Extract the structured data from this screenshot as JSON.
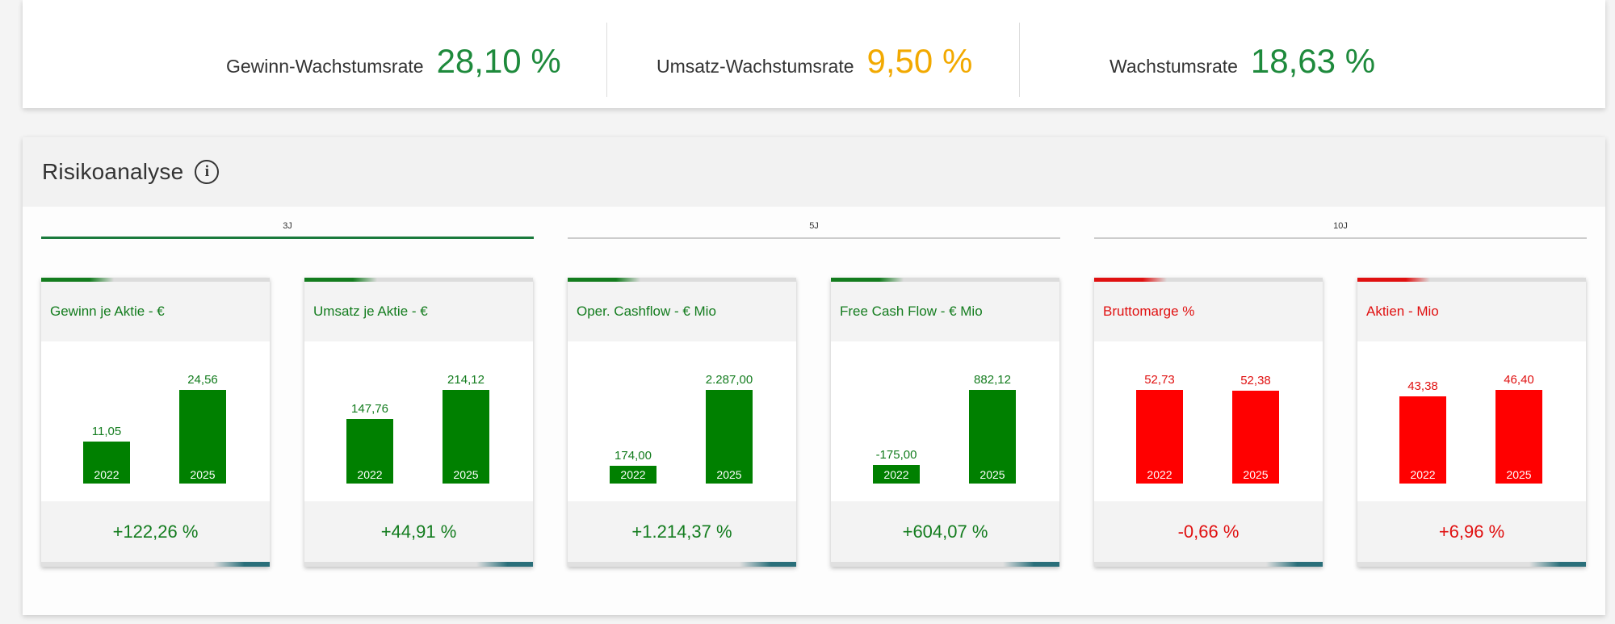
{
  "growth": [
    {
      "label": "Gewinn-Wachstumsrate",
      "value": "28,10 %",
      "tone": "green"
    },
    {
      "label": "Umsatz-Wachstumsrate",
      "value": "9,50 %",
      "tone": "amber"
    },
    {
      "label": "Wachstumsrate",
      "value": "18,63 %",
      "tone": "green"
    }
  ],
  "risk": {
    "title": "Risikoanalyse",
    "info_icon": "info-circle-icon",
    "periods": [
      {
        "label": "3J",
        "active": true
      },
      {
        "label": "5J",
        "active": false
      },
      {
        "label": "10J",
        "active": false
      }
    ],
    "cards": [
      {
        "title": "Gewinn je Aktie - €",
        "tone": "positive",
        "bars": [
          {
            "year": "2022",
            "value": "11,05",
            "num": 11.05
          },
          {
            "year": "2025",
            "value": "24,56",
            "num": 24.56
          }
        ],
        "change": "+122,26 %"
      },
      {
        "title": "Umsatz je Aktie - €",
        "tone": "positive",
        "bars": [
          {
            "year": "2022",
            "value": "147,76",
            "num": 147.76
          },
          {
            "year": "2025",
            "value": "214,12",
            "num": 214.12
          }
        ],
        "change": "+44,91 %"
      },
      {
        "title": "Oper. Cashflow - € Mio",
        "tone": "positive",
        "bars": [
          {
            "year": "2022",
            "value": "174,00",
            "num": 174.0
          },
          {
            "year": "2025",
            "value": "2.287,00",
            "num": 2287.0
          }
        ],
        "change": "+1.214,37 %"
      },
      {
        "title": "Free Cash Flow - € Mio",
        "tone": "positive",
        "bars": [
          {
            "year": "2022",
            "value": "-175,00",
            "num": -175.0
          },
          {
            "year": "2025",
            "value": "882,12",
            "num": 882.12
          }
        ],
        "change": "+604,07 %"
      },
      {
        "title": "Bruttomarge %",
        "tone": "negative",
        "bars": [
          {
            "year": "2022",
            "value": "52,73",
            "num": 52.73
          },
          {
            "year": "2025",
            "value": "52,38",
            "num": 52.38
          }
        ],
        "change": "-0,66 %"
      },
      {
        "title": "Aktien - Mio",
        "tone": "negative",
        "bars": [
          {
            "year": "2022",
            "value": "43,38",
            "num": 43.38
          },
          {
            "year": "2025",
            "value": "46,40",
            "num": 46.4
          }
        ],
        "change": "+6,96 %"
      }
    ]
  },
  "colors": {
    "positive": "#008000",
    "negative": "#ff0000",
    "growth_green": "#1e8a3c",
    "growth_amber": "#f2a900",
    "active_tab": "#1a7a3c"
  }
}
